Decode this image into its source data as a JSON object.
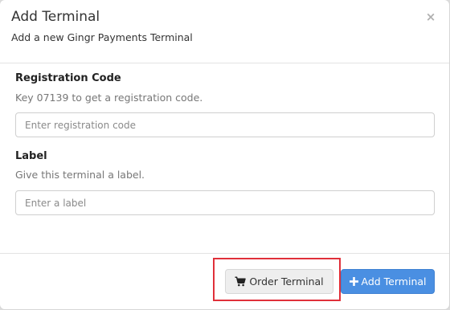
{
  "modal": {
    "title": "Add Terminal",
    "subtitle": "Add a new Gingr Payments Terminal",
    "close_glyph": "×"
  },
  "registration": {
    "label": "Registration Code",
    "help": "Key 07139 to get a registration code.",
    "placeholder": "Enter registration code",
    "value": ""
  },
  "label_field": {
    "label": "Label",
    "help": "Give this terminal a label.",
    "placeholder": "Enter a label",
    "value": ""
  },
  "footer": {
    "order_button": "Order Terminal",
    "order_icon": "shopping-cart-icon",
    "add_button": "Add Terminal",
    "add_icon": "plus-icon"
  },
  "colors": {
    "primary": "#4a8fe2",
    "highlight": "#e0303a"
  }
}
